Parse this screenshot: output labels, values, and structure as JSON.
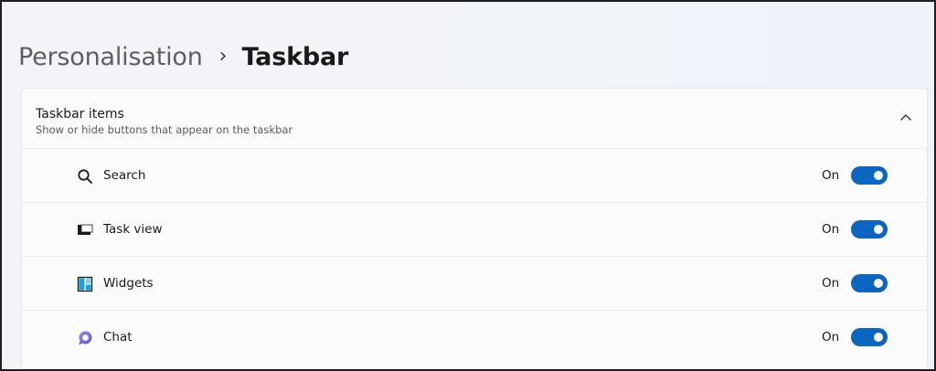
{
  "breadcrumb": {
    "parent": "Personalisation",
    "separator": "›",
    "current": "Taskbar"
  },
  "section": {
    "title": "Taskbar items",
    "subtitle": "Show or hide buttons that appear on the taskbar",
    "expand_icon": "chevron-up-icon"
  },
  "items": [
    {
      "label": "Search",
      "icon": "search-icon",
      "state": "On",
      "enabled": true
    },
    {
      "label": "Task view",
      "icon": "task-view-icon",
      "state": "On",
      "enabled": true
    },
    {
      "label": "Widgets",
      "icon": "widgets-icon",
      "state": "On",
      "enabled": true
    },
    {
      "label": "Chat",
      "icon": "chat-icon",
      "state": "On",
      "enabled": true
    }
  ],
  "colors": {
    "accent": "#0b66c2",
    "widgets_icon": "#1aa0d8",
    "chat_icon": "#7b68d9"
  }
}
